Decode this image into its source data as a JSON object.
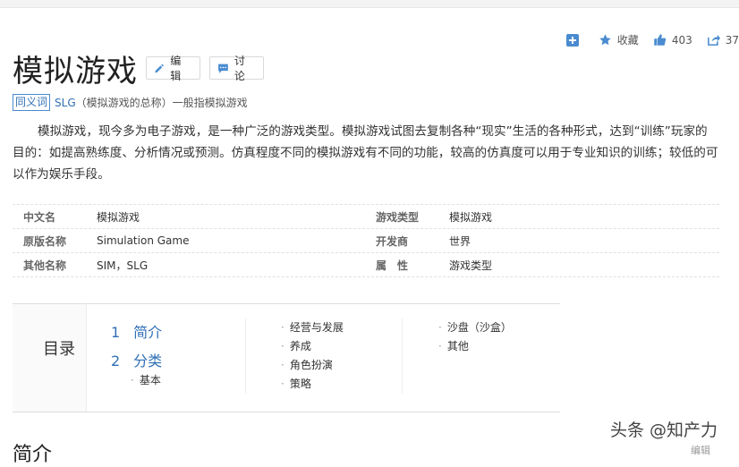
{
  "actions": {
    "collect_label": "收藏",
    "like_count": "403",
    "share_count": "37"
  },
  "title": "模拟游戏",
  "title_buttons": {
    "edit": "编辑",
    "discuss": "讨论"
  },
  "synonym": {
    "tag": "同义词",
    "link": "SLG",
    "text": "（模拟游戏的总称）一般指模拟游戏"
  },
  "summary": "模拟游戏，现今多为电子游戏，是一种广泛的游戏类型。模拟游戏试图去复制各种“现实”生活的各种形式，达到“训练”玩家的目的：如提高熟练度、分析情况或预测。仿真程度不同的模拟游戏有不同的功能，较高的仿真度可以用于专业知识的训练；较低的可以作为娱乐手段。",
  "info_rows": [
    {
      "l1": "中文名",
      "v1": "模拟游戏",
      "l2": "游戏类型",
      "v2": "模拟游戏"
    },
    {
      "l1": "原版名称",
      "v1": "Simulation Game",
      "l2": "开发商",
      "v2": "世界"
    },
    {
      "l1": "其他名称",
      "v1": "SIM，SLG",
      "l2": "属　性",
      "v2": "游戏类型"
    }
  ],
  "toc": {
    "title": "目录",
    "main": [
      {
        "num": "1",
        "label": "简介"
      },
      {
        "num": "2",
        "label": "分类"
      }
    ],
    "sub_under_2": "基本",
    "col2": [
      "经营与发展",
      "养成",
      "角色扮演",
      "策略"
    ],
    "col3": [
      "沙盘（沙盒）",
      "其他"
    ]
  },
  "next_section_title": "简介",
  "next_section_edit": "编辑",
  "watermark": "头条 @知产力",
  "colors": {
    "link": "#2f6fb5",
    "icon": "#4a8bd0"
  }
}
